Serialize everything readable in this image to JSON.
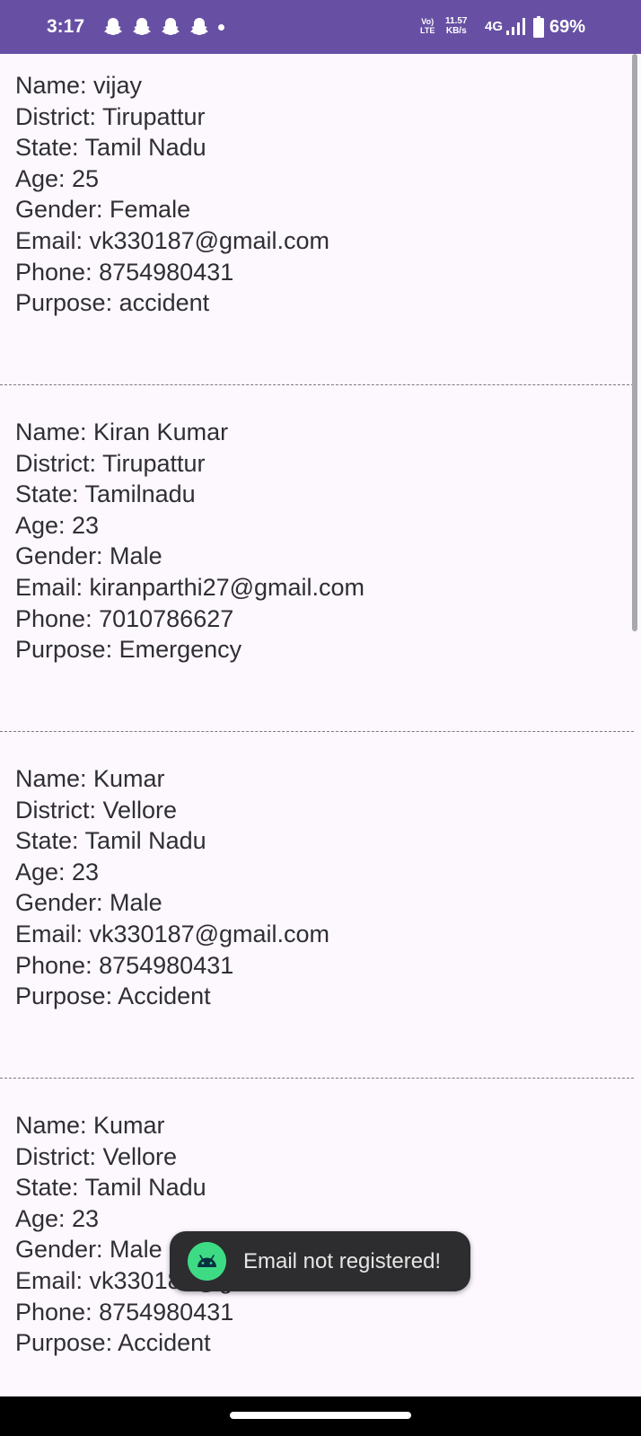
{
  "status_bar": {
    "time": "3:17",
    "notification_icons": [
      "snapchat-icon",
      "snapchat-icon",
      "snapchat-icon",
      "snapchat-icon"
    ],
    "volte_top": "Vo)",
    "volte_bottom": "LTE",
    "speed_value": "11.57",
    "speed_unit": "KB/s",
    "network": "4G",
    "battery_percent": "69%",
    "background_color": "#6750a4"
  },
  "records": [
    {
      "name": "Name: vijay",
      "district": "District: Tirupattur",
      "state": "State: Tamil Nadu",
      "age": "Age: 25",
      "gender": "Gender: Female",
      "email": "Email: vk330187@gmail.com",
      "phone": "Phone: 8754980431",
      "purpose": "Purpose: accident"
    },
    {
      "name": "Name: Kiran Kumar",
      "district": "District: Tirupattur",
      "state": "State: Tamilnadu",
      "age": "Age: 23",
      "gender": "Gender: Male",
      "email": "Email: kiranparthi27@gmail.com",
      "phone": "Phone: 7010786627",
      "purpose": "Purpose: Emergency"
    },
    {
      "name": "Name: Kumar",
      "district": "District: Vellore",
      "state": "State: Tamil Nadu",
      "age": "Age: 23",
      "gender": "Gender: Male",
      "email": "Email: vk330187@gmail.com",
      "phone": "Phone: 8754980431",
      "purpose": "Purpose: Accident"
    },
    {
      "name": "Name: Kumar",
      "district": "District: Vellore",
      "state": "State: Tamil Nadu",
      "age": "Age: 23",
      "gender": "Gender: Male",
      "email": "Email: vk330187@gmail.com",
      "phone": "Phone: 8754980431",
      "purpose": "Purpose: Accident"
    }
  ],
  "toast": {
    "message": "Email not registered!",
    "icon": "android-icon"
  }
}
